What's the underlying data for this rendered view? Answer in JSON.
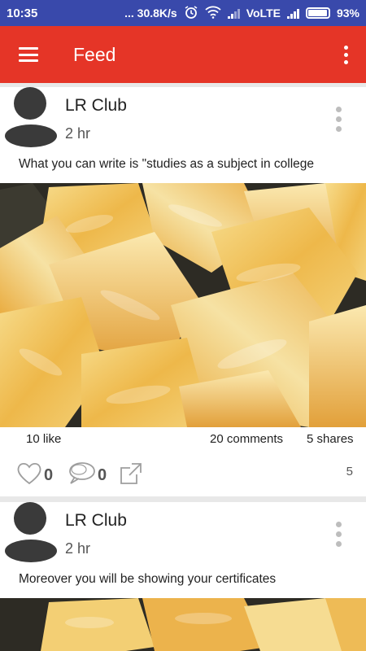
{
  "status_bar": {
    "time": "10:35",
    "network_speed": "... 30.8K/s",
    "volte": "VoLTE",
    "battery": "93%"
  },
  "app_bar": {
    "title": "Feed",
    "menu_icon": "hamburger-menu-icon",
    "overflow_icon": "more-vert-icon"
  },
  "posts": [
    {
      "author": "LR Club",
      "time": "2 hr",
      "text": "What you can write is \"studies as a subject in college",
      "image": "cheese cubes",
      "likes": "10  like",
      "comments": "20  comments",
      "shares": "5  shares",
      "like_count": "0",
      "comment_count": "0",
      "views": "5"
    },
    {
      "author": "LR Club",
      "time": "2 hr",
      "text": "Moreover you will be showing your certificates",
      "image": "cheese cubes"
    }
  ],
  "colors": {
    "status_bar": "#3949ab",
    "app_bar": "#e53527",
    "avatar": "#3a3a3a"
  }
}
